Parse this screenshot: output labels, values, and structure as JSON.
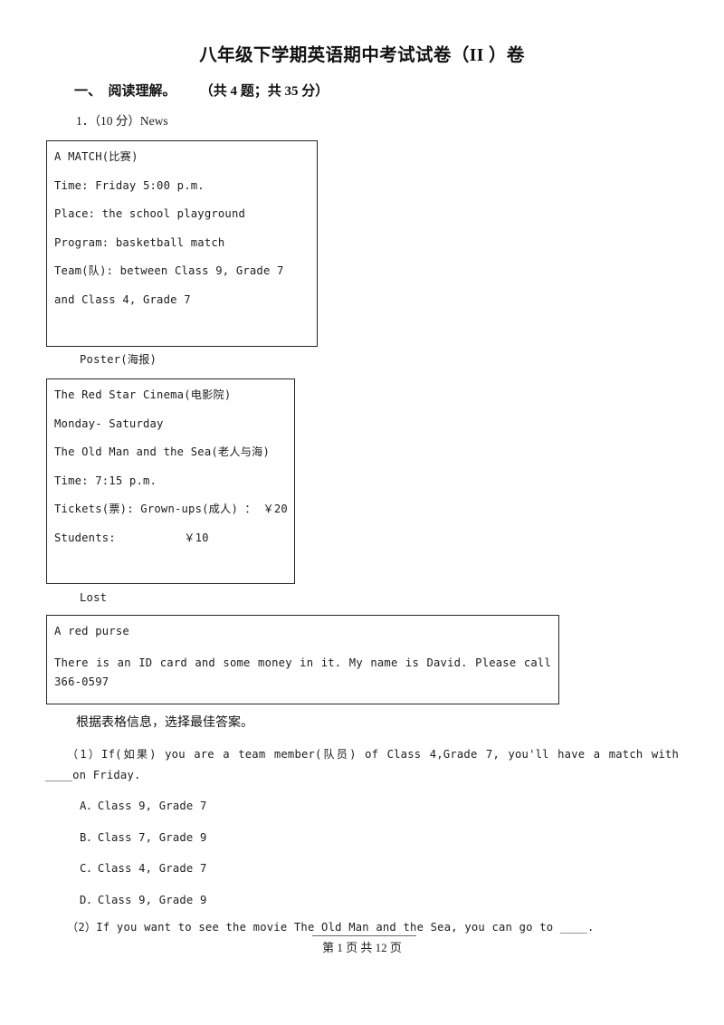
{
  "document": {
    "title": "八年级下学期英语期中考试试卷（II ）卷"
  },
  "section": {
    "heading": "一、  阅读理解。       （共 4 题；共 35 分）"
  },
  "question": {
    "number_line": "1．（10 分）News",
    "instruction": "根据表格信息，选择最佳答案。"
  },
  "boxes": {
    "match": {
      "lines": [
        "A MATCH(比赛)",
        "Time: Friday 5:00 p.m.",
        "Place: the school playground",
        "Program: basketball match",
        "Team(队): between Class 9, Grade 7",
        "and Class 4, Grade 7"
      ]
    },
    "poster_caption": "Poster(海报)",
    "cinema": {
      "lines": [
        "The Red Star Cinema(电影院)",
        "Monday- Saturday",
        "The Old Man and the Sea(老人与海)",
        "Time: 7:15 p.m.",
        "Tickets(票): Grown-ups(成人) ： ￥20",
        "Students:          ￥10"
      ]
    },
    "lost_caption": "Lost",
    "lost": {
      "title_line": "A red purse",
      "body_line": "There is an ID card and some money in it. My name is David. Please call 366-0597"
    }
  },
  "subquestions": [
    {
      "id": "1",
      "text": "（1）If(如果) you are a team member(队员) of Class 4,Grade 7, you'll have a match with ____on Friday.",
      "options": [
        "A．Class 9, Grade 7",
        "B．Class 7, Grade 9",
        "C．Class 4, Grade 7",
        "D．Class 9, Grade 9"
      ]
    },
    {
      "id": "2",
      "text": "（2）If you want to see the movie The Old Man and the Sea, you can go to ____."
    }
  ],
  "footer": {
    "text": "第 1 页 共 12 页"
  }
}
